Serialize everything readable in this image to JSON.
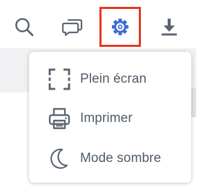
{
  "toolbar": {
    "buttons": [
      {
        "icon": "search-icon"
      },
      {
        "icon": "comments-icon"
      },
      {
        "icon": "gear-icon",
        "highlighted": true
      },
      {
        "icon": "download-icon"
      }
    ]
  },
  "settings_menu": {
    "items": [
      {
        "icon": "fullscreen-icon",
        "label": "Plein écran"
      },
      {
        "icon": "printer-icon",
        "label": "Imprimer"
      },
      {
        "icon": "moon-icon",
        "label": "Mode sombre"
      }
    ]
  },
  "colors": {
    "icon": "#5a6470",
    "label": "#505a66",
    "highlight_border": "#e8331f",
    "content_background": "#f1f1f4"
  }
}
